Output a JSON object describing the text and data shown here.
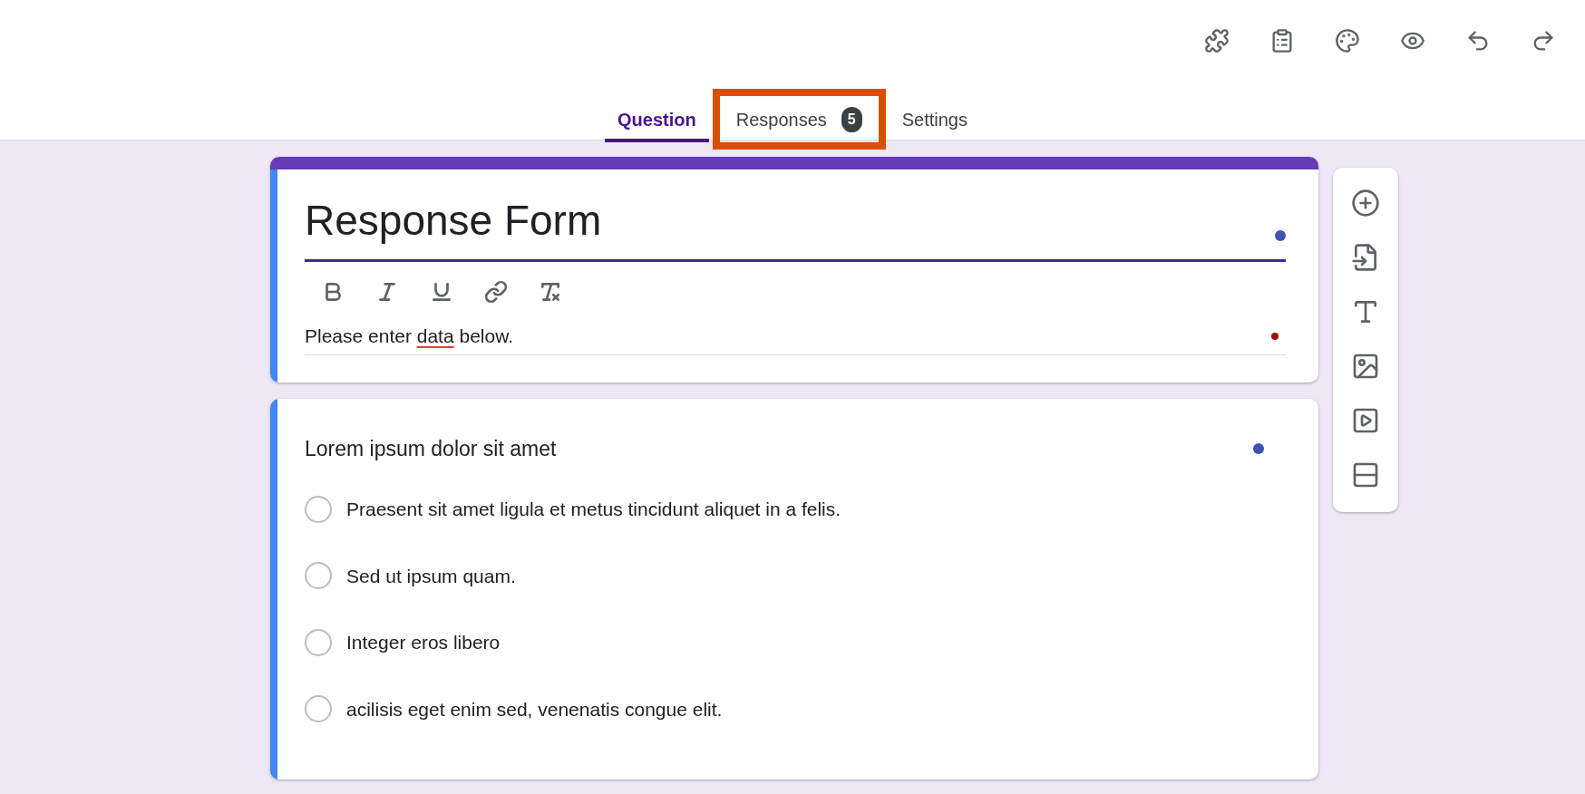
{
  "toolbar": [
    {
      "kind": "addons"
    },
    {
      "kind": "ai-form"
    },
    {
      "kind": "theme"
    },
    {
      "kind": "preview"
    },
    {
      "kind": "undo"
    },
    {
      "kind": "redo"
    }
  ],
  "tabs": [
    {
      "label": "Question",
      "selected": true,
      "highlighted": false
    },
    {
      "label": "Responses",
      "badge": "5",
      "selected": false,
      "highlighted": true
    },
    {
      "label": "Settings",
      "selected": false,
      "highlighted": false
    }
  ],
  "form_header": {
    "title": "Response Form",
    "format_tools": [
      {
        "kind": "bold"
      },
      {
        "kind": "italic"
      },
      {
        "kind": "underline"
      },
      {
        "kind": "link"
      },
      {
        "kind": "clear"
      }
    ],
    "description": [
      {
        "text": "Please enter ",
        "misspelled": false
      },
      {
        "text": "data",
        "misspelled": true
      },
      {
        "text": " below.",
        "misspelled": false
      }
    ]
  },
  "question": {
    "title": "Lorem ipsum dolor sit amet",
    "options": [
      {
        "label": "Praesent sit amet ligula et metus tincidunt aliquet in a felis.",
        "selected": false
      },
      {
        "label": "Sed ut ipsum quam.",
        "selected": false
      },
      {
        "label": "Integer eros libero",
        "selected": false
      },
      {
        "label": "acilisis eget enim sed, venenatis congue elit.",
        "selected": false
      }
    ]
  },
  "side_tools": [
    {
      "kind": "add-question"
    },
    {
      "kind": "import"
    },
    {
      "kind": "title"
    },
    {
      "kind": "image"
    },
    {
      "kind": "video"
    },
    {
      "kind": "section"
    }
  ]
}
